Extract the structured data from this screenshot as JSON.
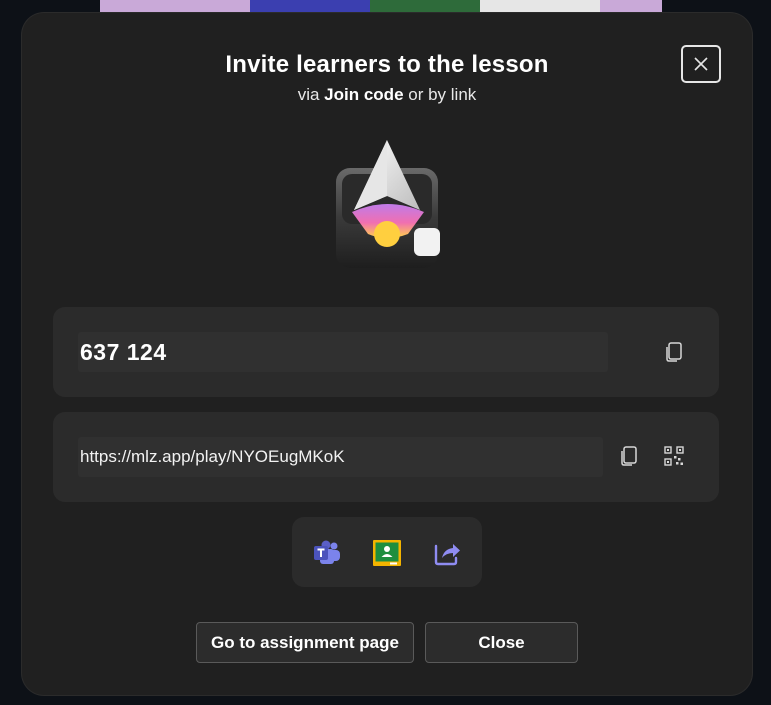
{
  "dialog": {
    "title": "Invite learners to the lesson",
    "subtitle_prefix": "via ",
    "subtitle_bold": "Join code",
    "subtitle_suffix": " or by link"
  },
  "join_code": {
    "value": "637 124"
  },
  "link": {
    "value": "https://mlz.app/play/NYOEugMKoK"
  },
  "icons": {
    "close": "close-icon",
    "copy_code": "copy-icon",
    "copy_link": "copy-icon",
    "qr": "qr-code-icon",
    "teams": "microsoft-teams-icon",
    "classroom": "google-classroom-icon",
    "share": "share-icon"
  },
  "buttons": {
    "assignment": "Go to assignment page",
    "close": "Close"
  },
  "colors": {
    "dialog_bg": "#202020",
    "card_bg": "#2b2b2b",
    "field_bg": "#303030",
    "teams": "#5b5fc7",
    "classroom_green": "#1e8e3e",
    "classroom_yellow": "#f4b400",
    "share": "#8f8cf2"
  }
}
